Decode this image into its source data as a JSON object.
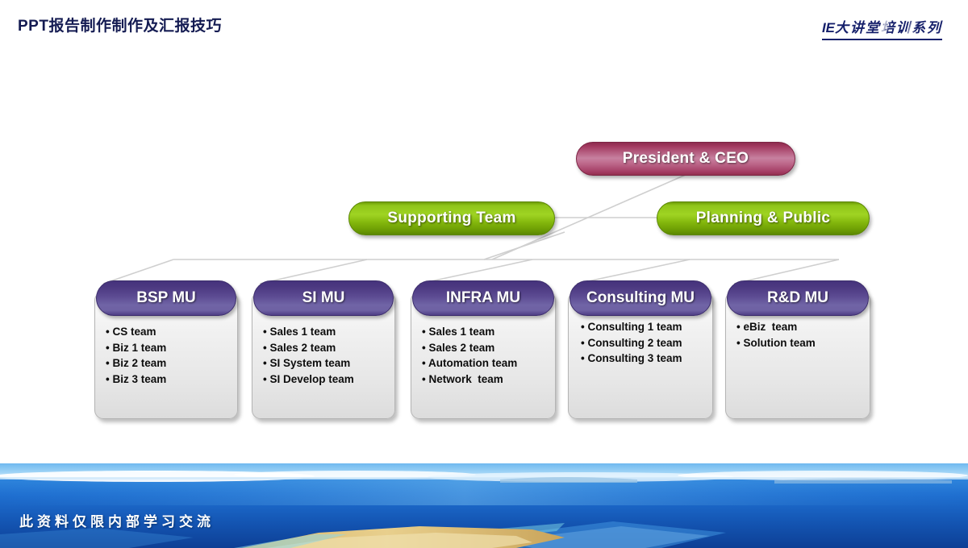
{
  "header": {
    "title": "PPT报告制作制作及汇报技巧",
    "logo_latin": "IE",
    "logo_cjk": "大讲堂培训系列"
  },
  "colors": {
    "title": "#141b52",
    "logo": "#16206b",
    "pink_pill": "#a33a60",
    "green_pill": "#8fc518",
    "purple_header": "#5d4c93",
    "box_body": "#ededed",
    "connector_line": "#cfcfcf",
    "footer_ocean": "#1f6fd0"
  },
  "org_chart": {
    "top_nodes": [
      {
        "id": "president",
        "label": "President & CEO",
        "style": "pink"
      },
      {
        "id": "supporting",
        "label": "Supporting Team",
        "style": "green"
      },
      {
        "id": "planning",
        "label": "Planning & Public",
        "style": "green"
      }
    ],
    "units": [
      {
        "id": "bsp-mu",
        "title": "BSP MU",
        "teams": [
          "CS team",
          "Biz 1 team",
          "Biz 2 team",
          "Biz 3 team"
        ]
      },
      {
        "id": "si-mu",
        "title": "SI MU",
        "teams": [
          "Sales 1 team",
          "Sales 2 team",
          "SI System team",
          "SI Develop team"
        ]
      },
      {
        "id": "infra-mu",
        "title": "INFRA MU",
        "teams": [
          "Sales 1 team",
          "Sales 2 team",
          "Automation team",
          "Network  team"
        ]
      },
      {
        "id": "consulting-mu",
        "title": "Consulting MU",
        "teams": [
          "Consulting 1 team",
          "Consulting 2 team",
          "Consulting 3 team"
        ]
      },
      {
        "id": "rd-mu",
        "title": "R&D MU",
        "teams": [
          "eBiz  team",
          "Solution team"
        ]
      }
    ]
  },
  "footer": {
    "note": "此资料仅限内部学习交流"
  }
}
